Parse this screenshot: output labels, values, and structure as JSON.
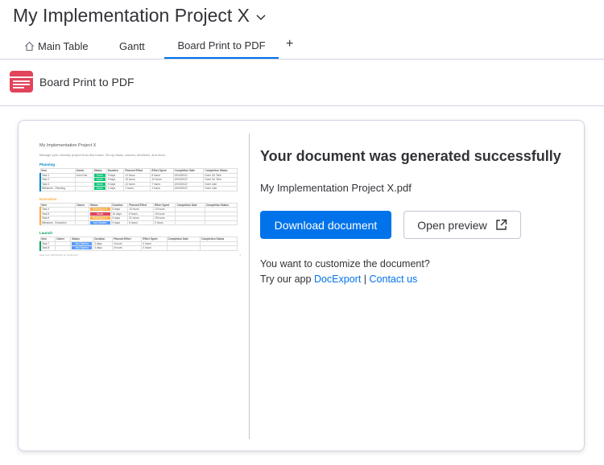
{
  "header": {
    "board_title": "My Implementation Project X"
  },
  "tabs": [
    {
      "label": "Main Table",
      "icon": "home-icon"
    },
    {
      "label": "Gantt"
    },
    {
      "label": "Board Print to PDF",
      "active": true
    }
  ],
  "tab_add_label": "+",
  "app": {
    "name": "Board Print to PDF",
    "icon": "pdf-app-icon",
    "icon_color": "#e2445c"
  },
  "result": {
    "heading": "Your document was generated successfully",
    "filename": "My Implementation Project X.pdf",
    "download_label": "Download document",
    "preview_label": "Open preview",
    "customize_line": "You want to customize the document?",
    "try_prefix": "Try our app",
    "docexport_link": "DocExport",
    "separator": "|",
    "contact_link": "Contact us"
  },
  "colors": {
    "primary": "#0073ea",
    "done": "#00c875",
    "working": "#fdab3d",
    "stuck": "#e2445c",
    "not_started": "#579bfc"
  },
  "doc_preview": {
    "title": "My Implementation Project X",
    "subtitle": "Manage your monday project from this board. Set up tasks, owners, timelines, and more.",
    "columns": [
      "Item",
      "Owner",
      "Status",
      "Duration",
      "Planned Effort",
      "Effort Spent",
      "Completion Date",
      "Completion Status"
    ],
    "groups": [
      {
        "name": "Planning",
        "color": "#0086c0",
        "rows": [
          [
            "Task 1",
            "John Doe",
            "Done",
            "9 days",
            "12 hours",
            "8 hours",
            "02/03/2022",
            "Done On Time"
          ],
          [
            "Task 2",
            "",
            "Done",
            "9 days",
            "18 hours",
            "10 hours",
            "19/03/2022",
            "Done On Time"
          ],
          [
            "Task 3",
            "",
            "Done",
            "9 days",
            "12 hours",
            "7 hours",
            "22/03/2022",
            "Done Late"
          ],
          [
            "Milestone - Planning",
            "",
            "Done",
            "1 days",
            "1 hours",
            "1 hours",
            "24/03/2022",
            "Done Late"
          ]
        ],
        "status_colors": [
          "#00c875",
          "#00c875",
          "#00c875",
          "#00c875"
        ]
      },
      {
        "name": "Execution",
        "color": "#fdab3d",
        "rows": [
          [
            "Task 4",
            "",
            "Working on it",
            "5 days",
            "10 hours",
            "10 hours",
            "",
            ""
          ],
          [
            "Task 5",
            "",
            "Stuck",
            "15 days",
            "8 hours",
            "10 hours",
            "",
            ""
          ],
          [
            "Task 6",
            "",
            "Working on it",
            "9 days",
            "21 hours",
            "15 hours",
            "",
            ""
          ],
          [
            "Milestone - Execution",
            "",
            "Not Started",
            "9 days",
            "8 hours",
            "0 hours",
            "",
            ""
          ]
        ],
        "status_colors": [
          "#fdab3d",
          "#e2445c",
          "#fdab3d",
          "#579bfc"
        ]
      },
      {
        "name": "Launch",
        "color": "#00a359",
        "rows": [
          [
            "Task 7",
            "",
            "Not Started",
            "3 days",
            "4 hours",
            "0 hours",
            "",
            ""
          ],
          [
            "Task 8",
            "",
            "Not Started",
            "3 days",
            "4 hours",
            "0 hours",
            "",
            ""
          ]
        ],
        "status_colors": [
          "#579bfc",
          "#579bfc"
        ]
      }
    ],
    "footer": "Data from 06/03/2022 by DocExport",
    "page_number": "1"
  }
}
